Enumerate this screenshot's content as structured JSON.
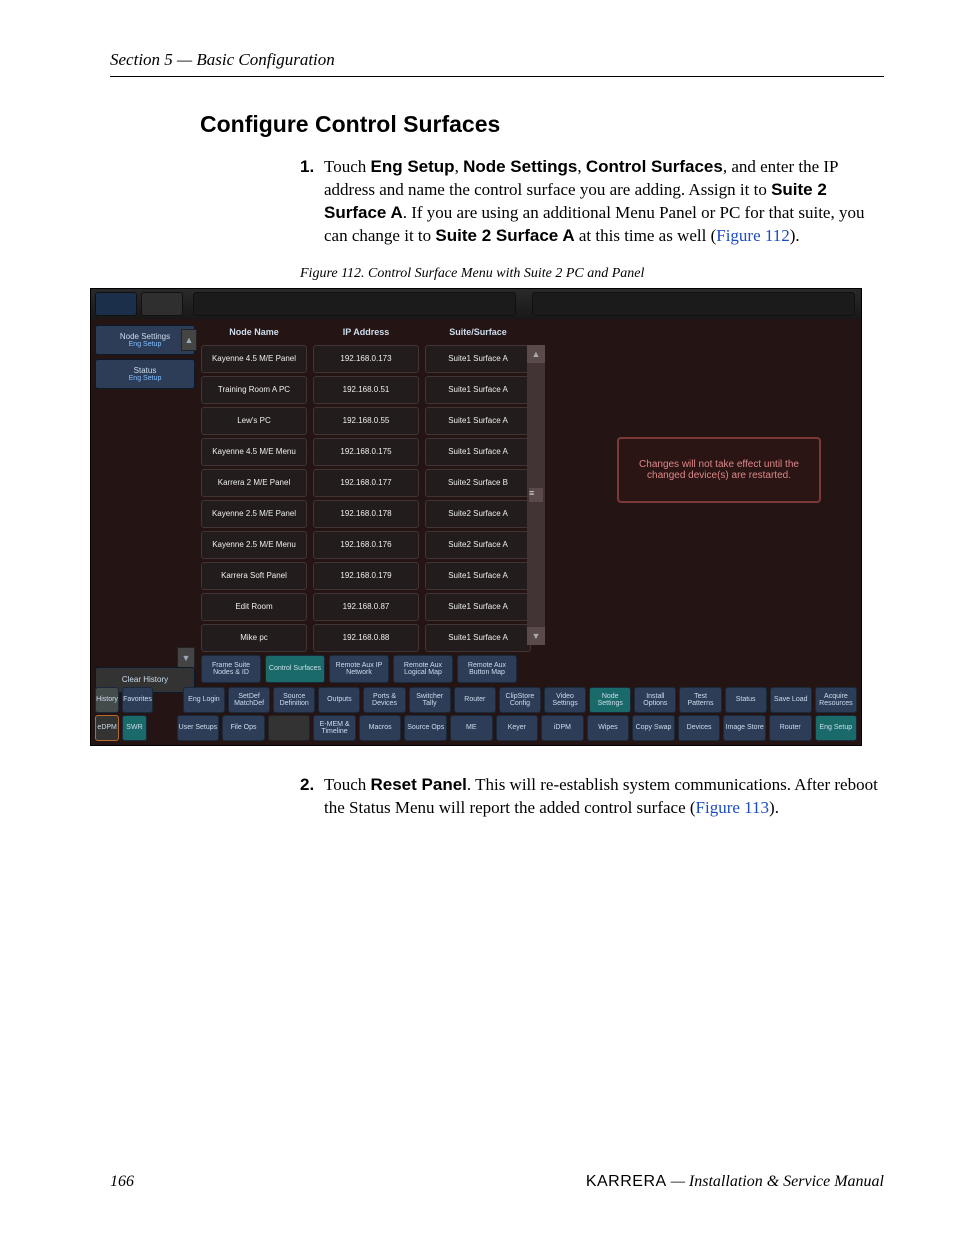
{
  "header": {
    "section": "Section 5 — Basic Configuration"
  },
  "title": "Configure Control Surfaces",
  "step1": {
    "num": "1.",
    "lead": "Touch ",
    "b1": "Eng Setup",
    "sep1": ", ",
    "b2": "Node Settings",
    "sep2": ", ",
    "b3": "Control Surfaces",
    "tail1": ", and enter the IP address and name the control surface you are adding. Assign it to ",
    "b4": "Suite 2 Surface A",
    "tail2": ". If you are using an additional Menu Panel or PC for that suite, you can change it to ",
    "b5": "Suite 2 Surface A",
    "tail3": " at this time as well (",
    "figref": "Figure 112",
    "tail4": ")."
  },
  "figcap": "Figure 112.  Control Surface Menu with Suite 2 PC and Panel",
  "step2": {
    "num": "2.",
    "lead": "Touch ",
    "b1": "Reset Panel",
    "tail1": ". This will re-establish system communications. After reboot the Status Menu will report the added control surface (",
    "figref": "Figure 113",
    "tail2": ")."
  },
  "footer": {
    "page": "166",
    "product": "KARRERA",
    "dash": " — ",
    "manual": "Installation & Service Manual"
  },
  "ui": {
    "side": {
      "node": "Node Settings",
      "node_sub": "Eng Setup",
      "status": "Status",
      "status_sub": "Eng Setup",
      "clear": "Clear History",
      "history": "History",
      "favorites": "Favorites",
      "edpm": "eDPM",
      "swr": "SWR"
    },
    "table": {
      "h1": "Node Name",
      "h2": "IP Address",
      "h3": "Suite/Surface",
      "rows": [
        {
          "name": "Kayenne 4.5 M/E Panel",
          "ip": "192.168.0.173",
          "suite": "Suite1 Surface A"
        },
        {
          "name": "Training Room A PC",
          "ip": "192.168.0.51",
          "suite": "Suite1 Surface A"
        },
        {
          "name": "Lew's PC",
          "ip": "192.168.0.55",
          "suite": "Suite1 Surface A"
        },
        {
          "name": "Kayenne 4.5 M/E Menu",
          "ip": "192.168.0.175",
          "suite": "Suite1 Surface A"
        },
        {
          "name": "Karrera 2 M/E Panel",
          "ip": "192.168.0.177",
          "suite": "Suite2 Surface B"
        },
        {
          "name": "Kayenne 2.5 M/E Panel",
          "ip": "192.168.0.178",
          "suite": "Suite2 Surface A"
        },
        {
          "name": "Kayenne 2.5 M/E Menu",
          "ip": "192.168.0.176",
          "suite": "Suite2 Surface A"
        },
        {
          "name": "Karrera Soft Panel",
          "ip": "192.168.0.179",
          "suite": "Suite1 Surface A"
        },
        {
          "name": "Edit Room",
          "ip": "192.168.0.87",
          "suite": "Suite1 Surface A"
        },
        {
          "name": "Mike pc",
          "ip": "192.168.0.88",
          "suite": "Suite1 Surface A"
        }
      ]
    },
    "notice": "Changes will not take effect until the changed device(s) are restarted.",
    "tabs": {
      "t0": "Frame Suite Nodes & ID",
      "t1": "Control Surfaces",
      "t2": "Remote Aux IP Network",
      "t3": "Remote Aux Logical Map",
      "t4": "Remote Aux Button Map"
    },
    "row1": {
      "b0": "Eng Login",
      "b1": "SetDef MatchDef",
      "b2": "Source Definition",
      "b3": "Outputs",
      "b4": "Ports & Devices",
      "b5": "Switcher Tally",
      "b6": "Router",
      "b7": "ClipStore Config",
      "b8": "Video Settings",
      "b9": "Node Settings",
      "b10": "Install Options",
      "b11": "Test Patterns",
      "b12": "Status",
      "b13": "Save Load",
      "b14": "Acquire Resources"
    },
    "row2": {
      "b0": "User Setups",
      "b1": "File Ops",
      "b2": "",
      "b3": "E-MEM & Timeline",
      "b4": "Macros",
      "b5": "Source Ops",
      "b6": "ME",
      "b7": "Keyer",
      "b8": "iDPM",
      "b9": "Wipes",
      "b10": "Copy Swap",
      "b11": "Devices",
      "b12": "Image Store",
      "b13": "Router",
      "b14": "Eng Setup"
    }
  }
}
